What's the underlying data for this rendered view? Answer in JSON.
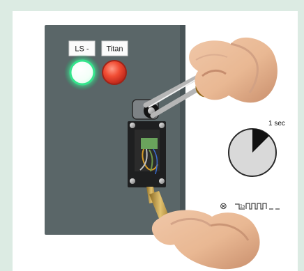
{
  "panel": {
    "label_left": "LS -",
    "label_right": "Titan"
  },
  "timer": {
    "duration_label": "1 sec",
    "elapsed_fraction": 0.125,
    "pulse_label": "1s"
  },
  "colors": {
    "background": "#dcebe3",
    "panel": "#5a6668",
    "lamp_white": "#ffffff",
    "lamp_red": "#e5412c",
    "lamp_green_glow": "#00d56a",
    "timer_fill": "#d9d9d9",
    "timer_wedge": "#111111"
  }
}
